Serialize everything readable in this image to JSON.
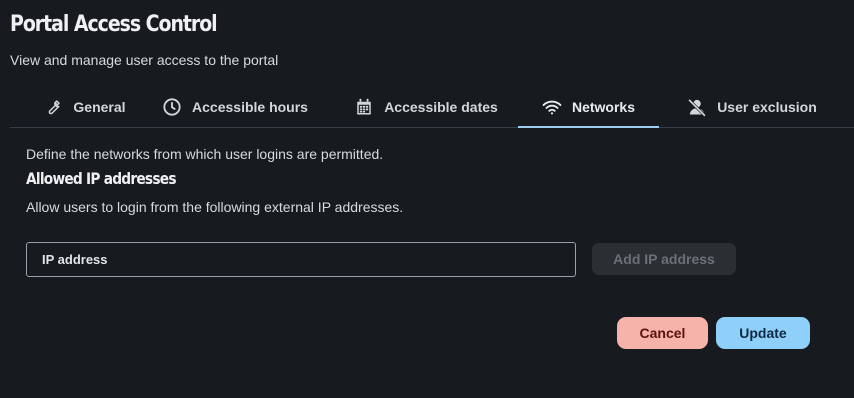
{
  "header": {
    "title": "Portal Access Control",
    "subtitle": "View and manage user access to the portal"
  },
  "tabs": [
    {
      "label": "General",
      "icon": "wrench-icon",
      "active": false
    },
    {
      "label": "Accessible hours",
      "icon": "clock-icon",
      "active": false
    },
    {
      "label": "Accessible dates",
      "icon": "calendar-icon",
      "active": false
    },
    {
      "label": "Networks",
      "icon": "wifi-icon",
      "active": true
    },
    {
      "label": "User exclusion",
      "icon": "user-off-icon",
      "active": false
    }
  ],
  "networks": {
    "description": "Define the networks from which user logins are permitted.",
    "section_title": "Allowed IP addresses",
    "section_description": "Allow users to login from the following external IP addresses.",
    "ip_input": {
      "placeholder": "IP address",
      "value": ""
    },
    "add_button_label": "Add IP address",
    "add_button_disabled": true
  },
  "actions": {
    "cancel_label": "Cancel",
    "update_label": "Update"
  },
  "colors": {
    "background": "#171b20",
    "active_tab_indicator": "#9ecbf0",
    "cancel": "#f5b3aa",
    "update": "#8fd0fb",
    "disabled_button": "#2b2f34"
  }
}
